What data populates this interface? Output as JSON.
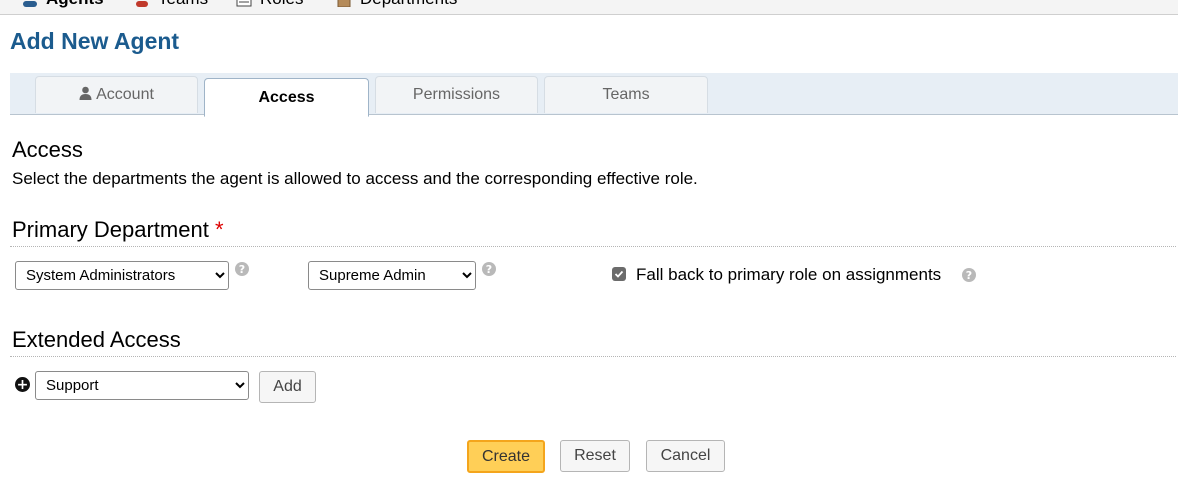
{
  "topnav": {
    "items": [
      {
        "label": "Agents",
        "icon": "agents-icon"
      },
      {
        "label": "Teams",
        "icon": "teams-icon"
      },
      {
        "label": "Roles",
        "icon": "roles-icon"
      },
      {
        "label": "Departments",
        "icon": "departments-icon"
      }
    ]
  },
  "page": {
    "title": "Add New Agent"
  },
  "tabs": [
    {
      "label": "Account",
      "icon": "user-icon"
    },
    {
      "label": "Access"
    },
    {
      "label": "Permissions"
    },
    {
      "label": "Teams"
    }
  ],
  "access": {
    "heading": "Access",
    "description": "Select the departments the agent is allowed to access and the corresponding effective role."
  },
  "primary": {
    "heading": "Primary Department",
    "required_mark": "*",
    "department_value": "System Administrators",
    "role_value": "Supreme Admin",
    "fallback_label": "Fall back to primary role on assignments",
    "fallback_checked": true,
    "help_glyph": "?"
  },
  "extended": {
    "heading": "Extended Access",
    "department_value": "Support",
    "add_label": "Add"
  },
  "buttons": {
    "create": "Create",
    "reset": "Reset",
    "cancel": "Cancel"
  },
  "colors": {
    "title": "#1b5b8e",
    "primary_button": "#ffcf57",
    "required": "#dd0000"
  }
}
